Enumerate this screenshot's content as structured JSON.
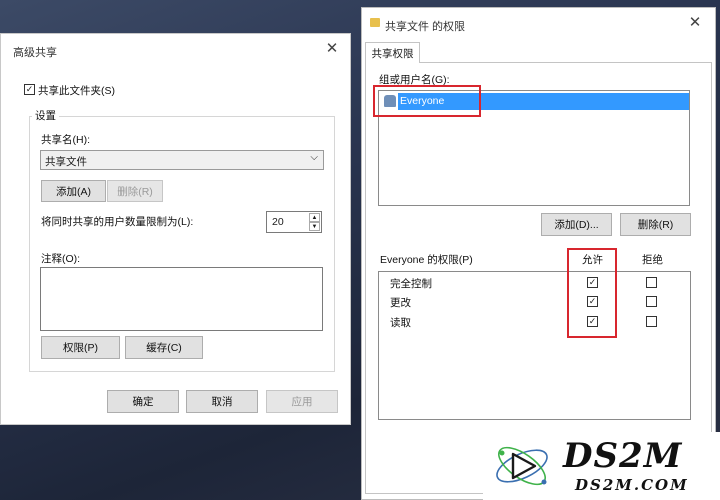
{
  "advanced": {
    "title": "高级共享",
    "share_checkbox_label": "共享此文件夹(S)",
    "share_checked": true,
    "settings_label": "设置",
    "share_name_label": "共享名(H):",
    "share_name_value": "共享文件",
    "add_label": "添加(A)",
    "remove_label": "删除(R)",
    "limit_label": "将同时共享的用户数量限制为(L):",
    "limit_value": "20",
    "comment_label": "注释(O):",
    "permissions_label": "权限(P)",
    "caching_label": "缓存(C)",
    "ok_label": "确定",
    "cancel_label": "取消",
    "apply_label": "应用"
  },
  "perm": {
    "title": "共享文件 的权限",
    "tab_label": "共享权限",
    "group_label": "组或用户名(G):",
    "selected_user": "Everyone",
    "add_label": "添加(D)...",
    "remove_label": "删除(R)",
    "perm_for_label": "Everyone 的权限(P)",
    "allow_header": "允许",
    "deny_header": "拒绝",
    "rows": [
      {
        "name": "完全控制",
        "allow": true,
        "deny": false
      },
      {
        "name": "更改",
        "allow": true,
        "deny": false
      },
      {
        "name": "读取",
        "allow": true,
        "deny": false
      }
    ]
  },
  "watermark": {
    "brand": "DS2M",
    "url": "DS2M.COM"
  },
  "colors": {
    "selection": "#3399ff",
    "highlight": "#d8262e"
  }
}
